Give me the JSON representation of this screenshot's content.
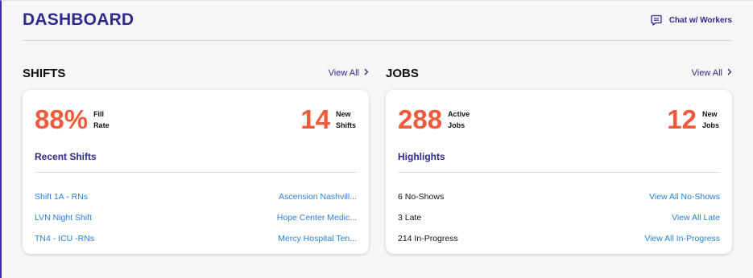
{
  "header": {
    "title": "DASHBOARD",
    "chat_label": "Chat w/ Workers"
  },
  "shifts": {
    "title": "SHIFTS",
    "view_all": "View All",
    "metric_left": {
      "value": "88%",
      "label_line1": "Fill",
      "label_line2": "Rate"
    },
    "metric_right": {
      "value": "14",
      "label_line1": "New",
      "label_line2": "Shifts"
    },
    "subtitle": "Recent Shifts",
    "rows": [
      {
        "name": "Shift 1A - RNs",
        "facility": "Ascension Nashvill..."
      },
      {
        "name": "LVN Night Shift",
        "facility": "Hope Center Medic..."
      },
      {
        "name": "TN4 - ICU -RNs",
        "facility": "Mercy Hospital Ten..."
      }
    ]
  },
  "jobs": {
    "title": "JOBS",
    "view_all": "View All",
    "metric_left": {
      "value": "288",
      "label_line1": "Active",
      "label_line2": "Jobs"
    },
    "metric_right": {
      "value": "12",
      "label_line1": "New",
      "label_line2": "Jobs"
    },
    "subtitle": "Highlights",
    "rows": [
      {
        "stat": "6 No-Shows",
        "action": "View All No-Shows"
      },
      {
        "stat": "3 Late",
        "action": "View All Late"
      },
      {
        "stat": "214 In-Progress",
        "action": "View All In-Progress"
      }
    ]
  },
  "colors": {
    "brand": "#2e2a8c",
    "metric": "#f05a3c",
    "link": "#2a7fd6"
  },
  "icons": {
    "chat": "chat-bubble-icon",
    "view_all_arrow": "chevron-right-icon"
  }
}
